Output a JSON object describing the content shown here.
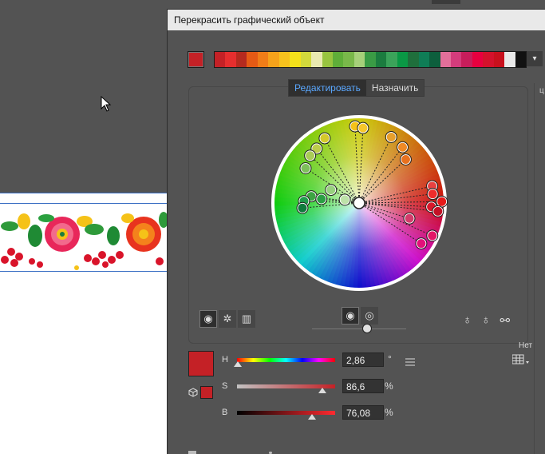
{
  "dialog": {
    "title": "Перекрасить графический объект",
    "edge_letter": "ц"
  },
  "tabs": [
    {
      "label": "Редактировать",
      "active": true
    },
    {
      "label": "Назначить",
      "active": false
    }
  ],
  "current_color": "#c42126",
  "color_strip": [
    "#c42126",
    "#e62e2e",
    "#b52a1f",
    "#e55a15",
    "#f07d18",
    "#f5a21b",
    "#f7c21e",
    "#f4e11b",
    "#d2d93c",
    "#e9e9b0",
    "#98c43f",
    "#5fae39",
    "#79b84a",
    "#a6d07a",
    "#3a9b45",
    "#1b7c3f",
    "#3ba35a",
    "#0a9845",
    "#1f6f3c",
    "#0f7d56",
    "#0d5f3d",
    "#e36f9a",
    "#d43c7c",
    "#c81d5b",
    "#e7003f",
    "#d4112c",
    "#c8101d",
    "#e9e9e9",
    "#111111"
  ],
  "wheel": {
    "center_handle_color": "#ffffff",
    "handles": [
      {
        "color": "#f5c218",
        "angle": 93,
        "r": 0.89
      },
      {
        "color": "#f6c72b",
        "angle": 87,
        "r": 0.87
      },
      {
        "color": "#e8a02c",
        "angle": 64,
        "r": 0.85
      },
      {
        "color": "#ef8a26",
        "angle": 52,
        "r": 0.82
      },
      {
        "color": "#e8711f",
        "angle": 43,
        "r": 0.74
      },
      {
        "color": "#d4c92a",
        "angle": 118,
        "r": 0.85
      },
      {
        "color": "#bccc4a",
        "angle": 128,
        "r": 0.8
      },
      {
        "color": "#a9cc57",
        "angle": 136,
        "r": 0.79
      },
      {
        "color": "#7dbf5a",
        "angle": 147,
        "r": 0.74
      },
      {
        "color": "#98d07f",
        "angle": 155,
        "r": 0.36
      },
      {
        "color": "#bde2a8",
        "angle": 167,
        "r": 0.17
      },
      {
        "color": "#3da543",
        "angle": 172,
        "r": 0.56
      },
      {
        "color": "#2b9f43",
        "angle": 174,
        "r": 0.44
      },
      {
        "color": "#1f9c4a",
        "angle": 178,
        "r": 0.64
      },
      {
        "color": "#0f7a3c",
        "angle": 185,
        "r": 0.66
      },
      {
        "color": "#e84141",
        "angle": 13,
        "r": 0.87
      },
      {
        "color": "#ee2c2c",
        "angle": 7,
        "r": 0.86
      },
      {
        "color": "#e61919",
        "angle": 1,
        "r": 0.96
      },
      {
        "color": "#d9182b",
        "angle": -3,
        "r": 0.84
      },
      {
        "color": "#c41226",
        "angle": -6,
        "r": 0.92
      },
      {
        "color": "#d43b6b",
        "angle": -17,
        "r": 0.61
      },
      {
        "color": "#e31767",
        "angle": -24,
        "r": 0.93
      },
      {
        "color": "#e3107a",
        "angle": -33,
        "r": 0.86
      }
    ]
  },
  "mode_buttons": [
    "circle-mode-icon",
    "segmented-mode-icon",
    "bars-mode-icon"
  ],
  "assign": {
    "none_label": "Нет"
  },
  "sliders": [
    {
      "label": "H",
      "value": "2,86",
      "unit": "°",
      "fraction": 0.008
    },
    {
      "label": "S",
      "value": "86,6",
      "unit": "%",
      "fraction": 0.866
    },
    {
      "label": "B",
      "value": "76,08",
      "unit": "%",
      "fraction": 0.761
    }
  ]
}
